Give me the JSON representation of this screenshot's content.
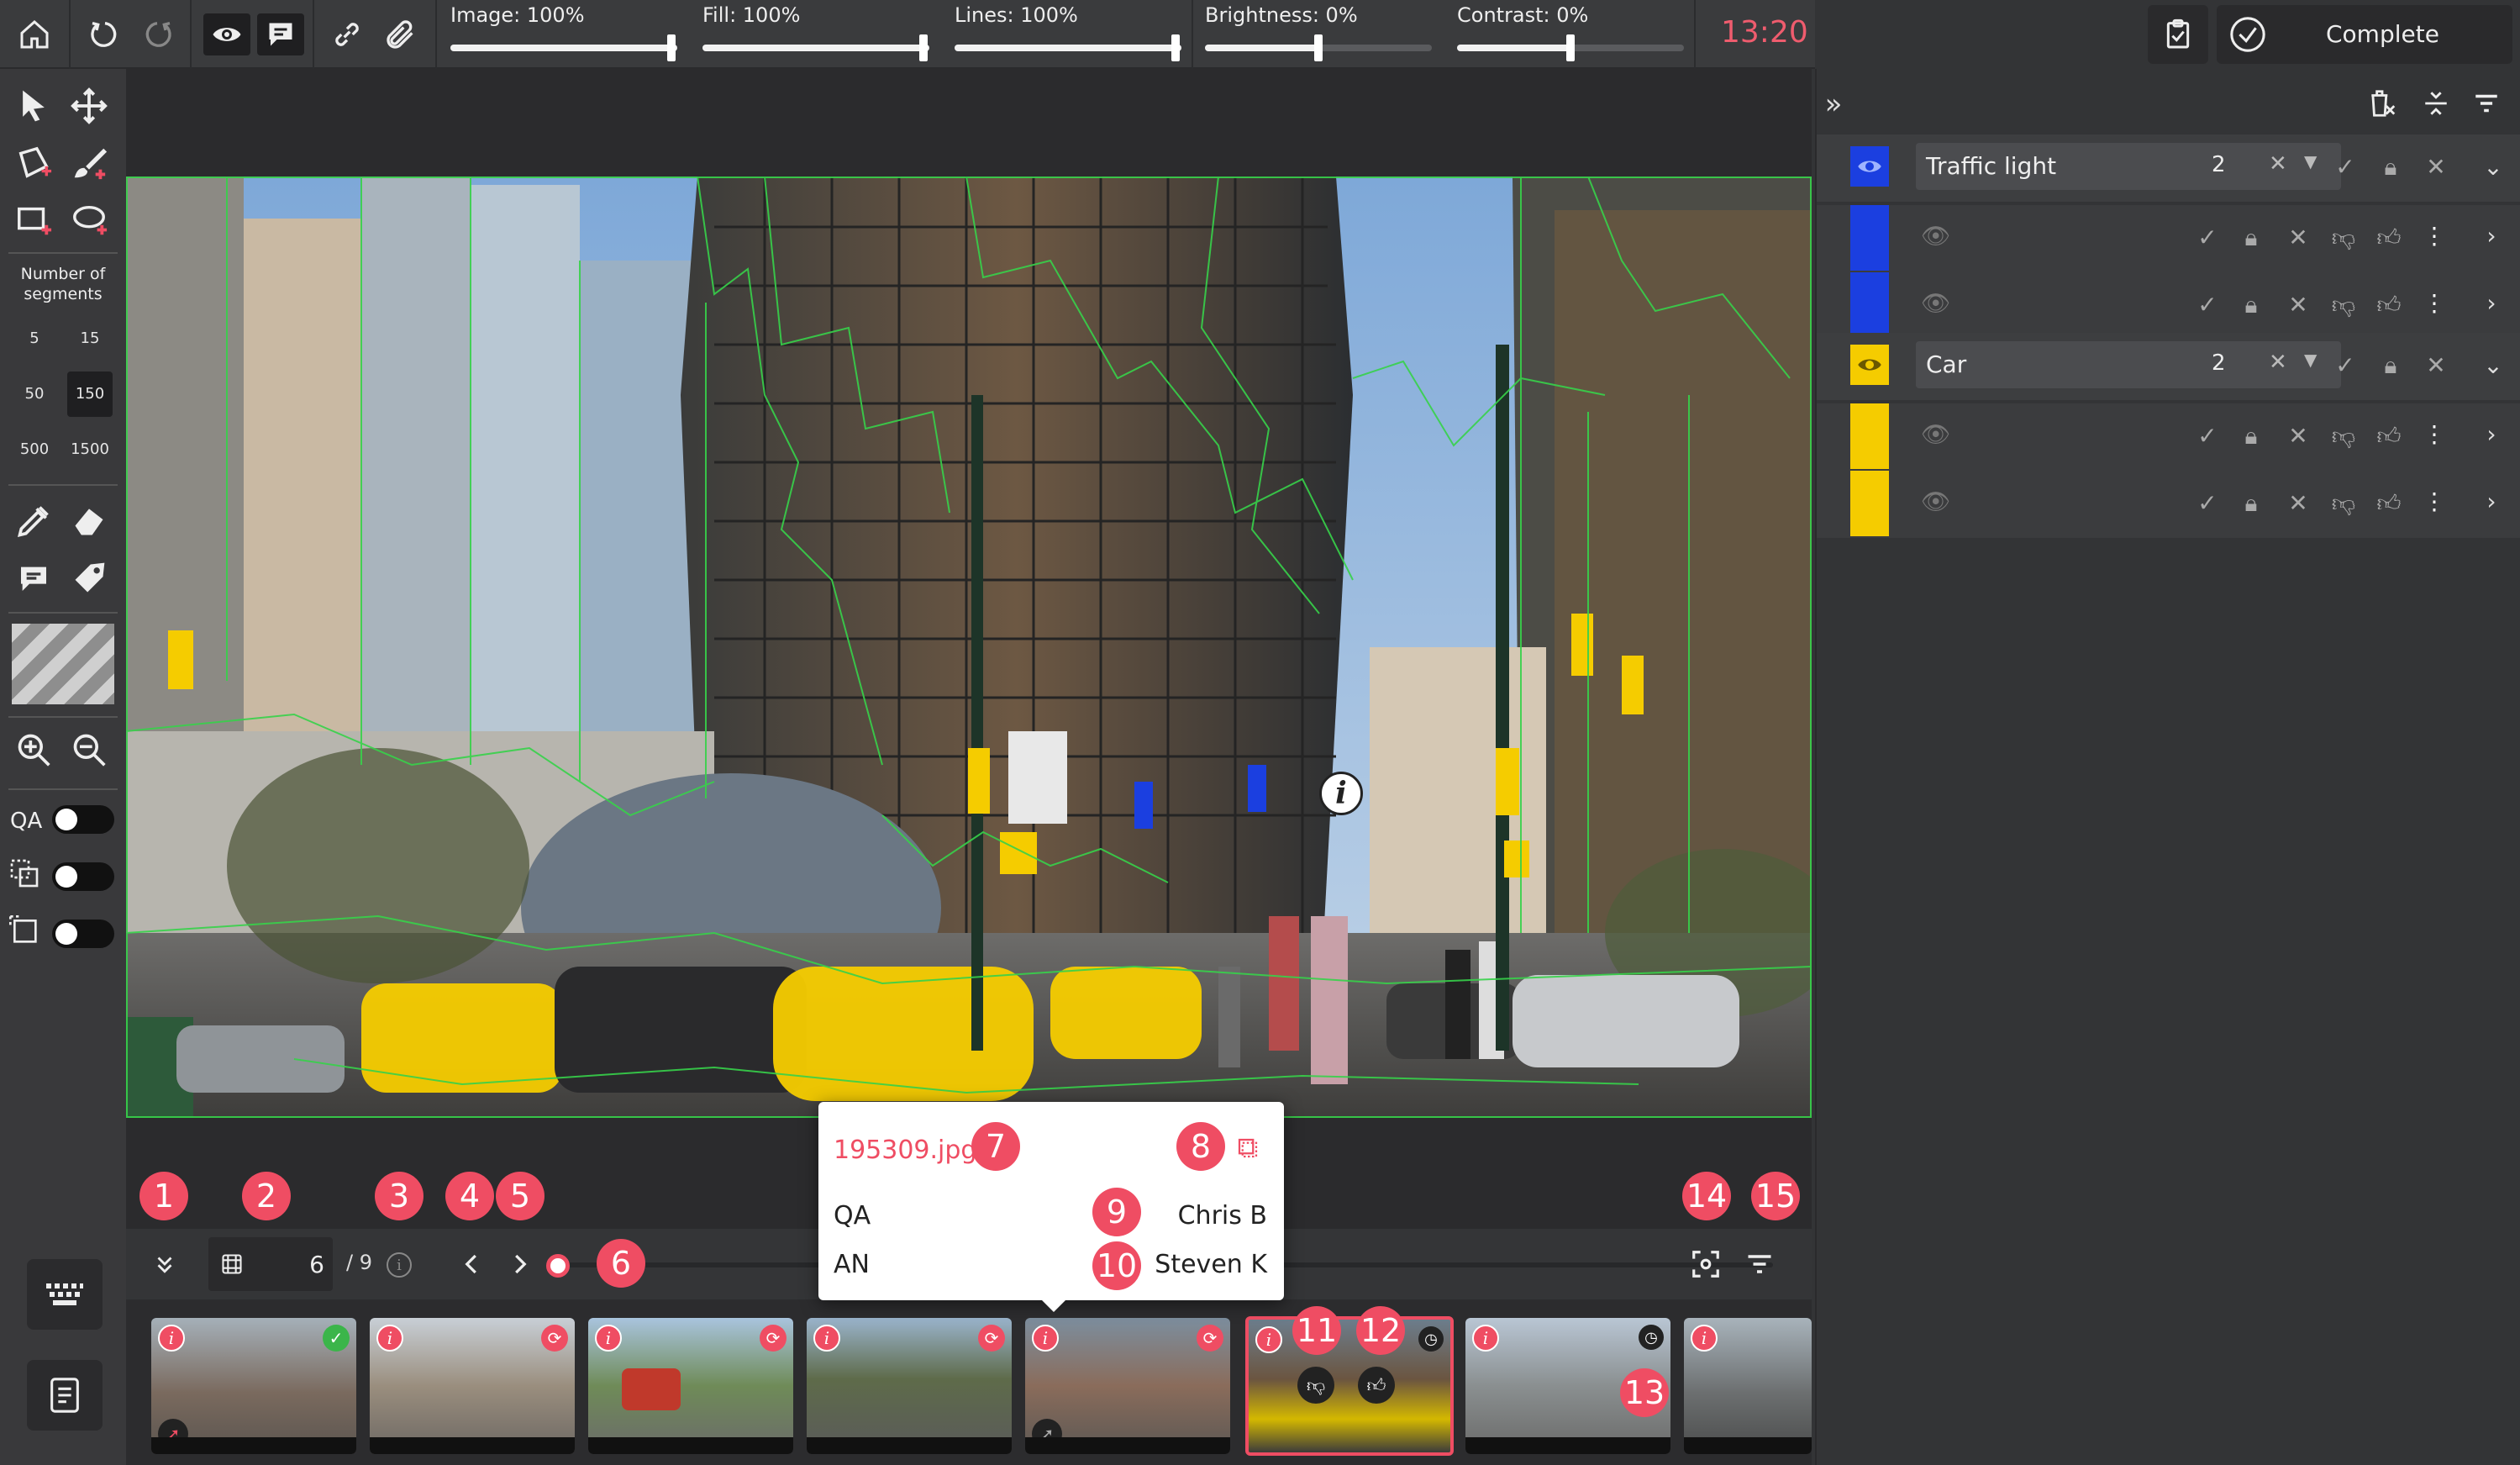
{
  "toolbar": {
    "sliders": [
      {
        "label": "Image: 100%",
        "value": 100
      },
      {
        "label": "Fill: 100%",
        "value": 100
      },
      {
        "label": "Lines: 100%",
        "value": 100
      },
      {
        "label": "Brightness: 0%",
        "value": 50
      },
      {
        "label": "Contrast: 0%",
        "value": 50
      }
    ],
    "timer": "13:20",
    "complete_label": "Complete"
  },
  "left_tools": {
    "segments_title": "Number of segments",
    "segment_options": [
      "5",
      "15",
      "50",
      "150",
      "500",
      "1500"
    ],
    "selected_segment": "150",
    "qa_label": "QA"
  },
  "image_annotation": {
    "info_symbol": "i"
  },
  "bottom": {
    "frame_current": "6",
    "frame_total": "/ 9",
    "markers": [
      "1",
      "2",
      "3",
      "4",
      "5",
      "6",
      "14",
      "15"
    ]
  },
  "popup": {
    "filename": "195309.jpg",
    "rows": [
      {
        "role": "QA",
        "name": "Chris B"
      },
      {
        "role": "AN",
        "name": "Steven K"
      }
    ],
    "markers": [
      "7",
      "8",
      "9",
      "10"
    ]
  },
  "thumbs": {
    "count": 8,
    "selected_index": 5,
    "markers": [
      "11",
      "12",
      "13"
    ]
  },
  "right_panel": {
    "classes": [
      {
        "name": "Traffic light",
        "count": "2",
        "color": "#0f3fe0",
        "instances": 2
      },
      {
        "name": "Car",
        "count": "2",
        "color": "#f5cc00",
        "instances": 2
      }
    ]
  }
}
